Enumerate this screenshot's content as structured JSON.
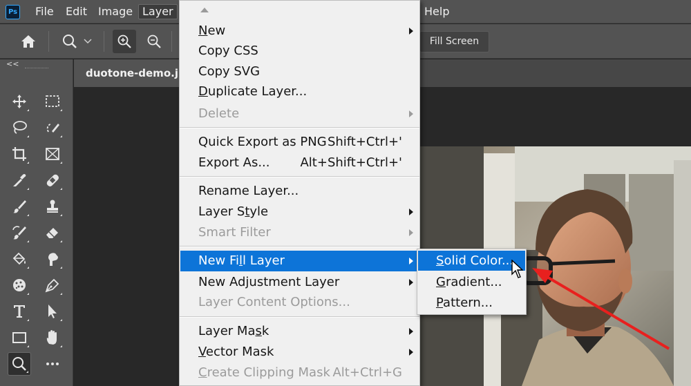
{
  "app": {
    "logo_text": "Ps",
    "accent": "#31a8ff"
  },
  "menubar": {
    "items": [
      {
        "label": "File"
      },
      {
        "label": "Edit"
      },
      {
        "label": "Image"
      },
      {
        "label": "Layer"
      },
      {
        "label": "Help"
      }
    ]
  },
  "options_bar": {
    "fill_screen_label": "Fill Screen",
    "icons": [
      "home-icon",
      "zoom-icon",
      "chevron-down-icon",
      "zoom-in-icon",
      "zoom-out-icon"
    ]
  },
  "toolbar": {
    "collapse_label": "<<",
    "tools": [
      "move",
      "marquee",
      "lasso",
      "object-select",
      "crop",
      "frame",
      "eyedropper",
      "healing",
      "brush",
      "stamp",
      "history-brush",
      "eraser",
      "paint-bucket",
      "smudge",
      "sponge",
      "pen",
      "type",
      "path-select",
      "rectangle",
      "hand",
      "zoom",
      "more"
    ],
    "selected_tool": "zoom"
  },
  "document": {
    "tab_title": "duotone-demo.jpg"
  },
  "layer_menu": {
    "items": [
      {
        "label": "New",
        "mnemonic_index": 0,
        "shortcut": "",
        "submenu": true,
        "disabled": false,
        "highlighted": false
      },
      {
        "label": "Copy CSS",
        "shortcut": "",
        "submenu": false,
        "disabled": false,
        "highlighted": false
      },
      {
        "label": "Copy SVG",
        "shortcut": "",
        "submenu": false,
        "disabled": false,
        "highlighted": false
      },
      {
        "label": "Duplicate Layer...",
        "mnemonic_index": 0,
        "shortcut": "",
        "submenu": false,
        "disabled": false,
        "highlighted": false
      },
      {
        "label": "Delete",
        "shortcut": "",
        "submenu": true,
        "disabled": true,
        "highlighted": false
      },
      {
        "label": "Quick Export as PNG",
        "shortcut": "Shift+Ctrl+'",
        "submenu": false,
        "disabled": false,
        "highlighted": false
      },
      {
        "label": "Export As...",
        "shortcut": "Alt+Shift+Ctrl+'",
        "submenu": false,
        "disabled": false,
        "highlighted": false
      },
      {
        "label": "Rename Layer...",
        "shortcut": "",
        "submenu": false,
        "disabled": false,
        "highlighted": false
      },
      {
        "label": "Layer Style",
        "mnemonic_index": 7,
        "shortcut": "",
        "submenu": true,
        "disabled": false,
        "highlighted": false
      },
      {
        "label": "Smart Filter",
        "shortcut": "",
        "submenu": true,
        "disabled": true,
        "highlighted": false
      },
      {
        "label": "New Fill Layer",
        "mnemonic_index": 6,
        "shortcut": "",
        "submenu": true,
        "disabled": false,
        "highlighted": true
      },
      {
        "label": "New Adjustment Layer",
        "shortcut": "",
        "submenu": true,
        "disabled": false,
        "highlighted": false
      },
      {
        "label": "Layer Content Options...",
        "shortcut": "",
        "submenu": false,
        "disabled": true,
        "highlighted": false
      },
      {
        "label": "Layer Mask",
        "mnemonic_index": 8,
        "shortcut": "",
        "submenu": true,
        "disabled": false,
        "highlighted": false
      },
      {
        "label": "Vector Mask",
        "mnemonic_index": 0,
        "shortcut": "",
        "submenu": true,
        "disabled": false,
        "highlighted": false
      },
      {
        "label": "Create Clipping Mask",
        "mnemonic_index": 0,
        "shortcut": "Alt+Ctrl+G",
        "submenu": false,
        "disabled": true,
        "highlighted": false
      }
    ]
  },
  "fill_submenu": {
    "items": [
      {
        "label": "Solid Color...",
        "mnemonic_index": 0,
        "highlighted": true
      },
      {
        "label": "Gradient...",
        "mnemonic_index": 0,
        "highlighted": false
      },
      {
        "label": "Pattern...",
        "mnemonic_index": 0,
        "highlighted": false
      }
    ]
  },
  "colors": {
    "highlight": "#0d74d8",
    "annotation_arrow": "#e8201e"
  }
}
